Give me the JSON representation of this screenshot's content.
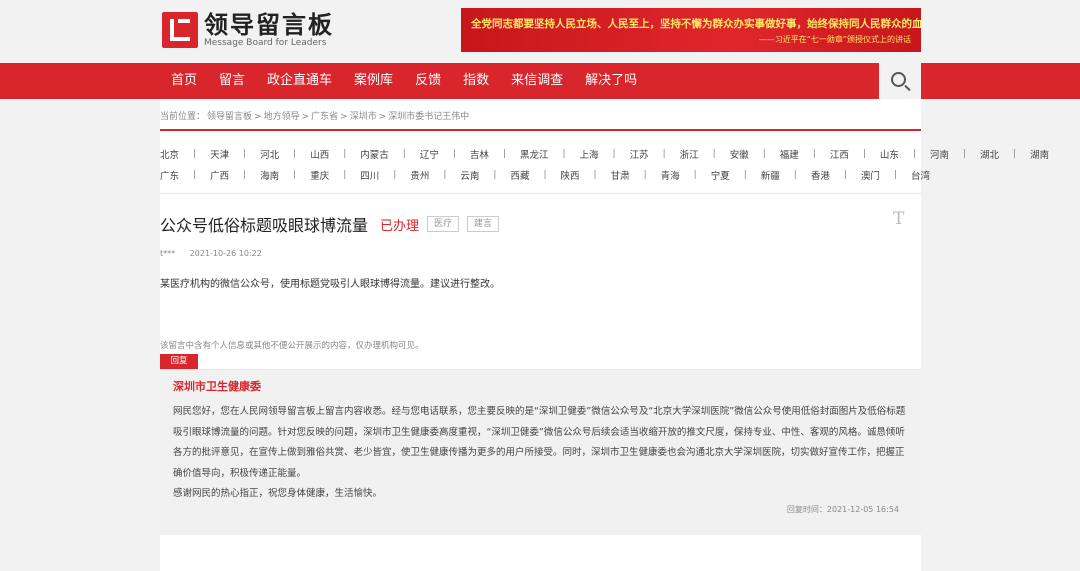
{
  "header": {
    "logo_cn": "领导留言板",
    "logo_en": "Message Board for Leaders",
    "banner_main": "全党同志都要坚持人民立场、人民至上，坚持不懈为群众办实事做好事，始终保持同人民群众的血肉联系。",
    "banner_sub": "——习近平在“七一勋章”颁授仪式上的讲话"
  },
  "nav": {
    "items": [
      "首页",
      "留言",
      "政企直通车",
      "案例库",
      "反馈",
      "指数",
      "来信调查",
      "解决了吗"
    ]
  },
  "breadcrumb": {
    "prefix": "当前位置：",
    "items": [
      "领导留言板",
      "地方领导",
      "广东省",
      "深圳市",
      "深圳市委书记王伟中"
    ],
    "separator": ">"
  },
  "regions": {
    "row1": [
      "北京",
      "天津",
      "河北",
      "山西",
      "内蒙古",
      "辽宁",
      "吉林",
      "黑龙江",
      "上海",
      "江苏",
      "浙江",
      "安徽",
      "福建",
      "江西",
      "山东",
      "河南",
      "湖北",
      "湖南"
    ],
    "row2": [
      "广东",
      "广西",
      "海南",
      "重庆",
      "四川",
      "贵州",
      "云南",
      "西藏",
      "陕西",
      "甘肃",
      "青海",
      "宁夏",
      "新疆",
      "香港",
      "澳门",
      "台湾"
    ],
    "separator": "|"
  },
  "message": {
    "title": "公众号低俗标题吸眼球博流量",
    "status": "已办理",
    "tags": [
      "医疗",
      "建言"
    ],
    "font_toggle": "T",
    "author": "t***",
    "date": "2021-10-26 10:22",
    "content": "某医疗机构的微信公众号，使用标题党吸引人眼球博得流量。建议进行整改。",
    "privacy_note": "该留言中含有个人信息或其他不便公开展示的内容，仅办理机构可见。"
  },
  "reply": {
    "badge": "回复",
    "org": "深圳市卫生健康委",
    "paragraph1": "网民您好，您在人民网领导留言板上留言内容收悉。经与您电话联系，您主要反映的是“深圳卫健委”微信公众号及“北京大学深圳医院”微信公众号使用低俗封面图片及低俗标题吸引眼球博流量的问题。针对您反映的问题，深圳市卫生健康委高度重视，“深圳卫健委”微信公众号后续会适当收缩开放的推文尺度，保持专业、中性、客观的风格。诚恳倾听各方的批评意见，在宣传上做到雅俗共赏、老少皆宜，使卫生健康传播为更多的用户所接受。同时，深圳市卫生健康委也会沟通北京大学深圳医院，切实做好宣传工作，把握正确价值导向，积极传递正能量。",
    "paragraph2": "感谢网民的热心指正，祝您身体健康，生活愉快。",
    "time_label": "回复时间：",
    "time": "2021-12-05 16:54"
  },
  "colors": {
    "brand_red": "#d8262c",
    "banner_text": "#ffe766"
  }
}
